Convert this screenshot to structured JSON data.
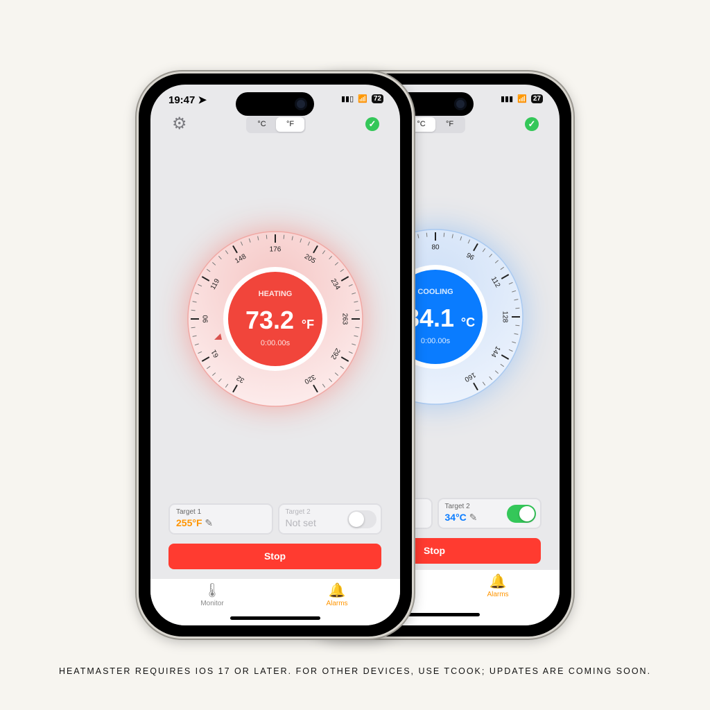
{
  "caption": "HEATMASTER REQUIRES IOS 17 OR LATER. FOR OTHER DEVICES, USE TCOOK; UPDATES ARE COMING SOON.",
  "colors": {
    "heat": "#f1453b",
    "cool": "#0a7cff",
    "accent_orange": "#ff9500",
    "success": "#34c759",
    "stop": "#ff3b30"
  },
  "front": {
    "time": "19:47",
    "battery": "72",
    "units": [
      "°C",
      "°F"
    ],
    "selected_unit": "°F",
    "dial": {
      "mode": "HEATING",
      "temp": "73.2",
      "unit": "°F",
      "timer": "0:00.00s",
      "labels": [
        "32",
        "61",
        "90",
        "119",
        "148",
        "176",
        "205",
        "234",
        "263",
        "292",
        "320"
      ],
      "marker_value": 73
    },
    "target1": {
      "label": "Target 1",
      "value": "255°F"
    },
    "target2": {
      "label": "Target 2",
      "value": "Not set",
      "enabled": false
    },
    "stop": "Stop",
    "tabs": [
      {
        "label": "Monitor",
        "icon": "thermometer-sun-icon"
      },
      {
        "label": "Alarms",
        "icon": "bell-icon"
      }
    ]
  },
  "back": {
    "battery": "27",
    "units": [
      "°C",
      "°F"
    ],
    "selected_unit": "°C",
    "dial": {
      "mode": "COOLING",
      "temp": "34.1",
      "unit": "°C",
      "timer": "0:00.00s",
      "labels": [
        "80",
        "96",
        "112",
        "128",
        "144",
        "160"
      ]
    },
    "target2": {
      "label": "Target 2",
      "value": "34°C",
      "enabled": true
    },
    "stop": "Stop",
    "tabs": [
      {
        "label": "Alarms",
        "icon": "bell-icon"
      }
    ]
  }
}
